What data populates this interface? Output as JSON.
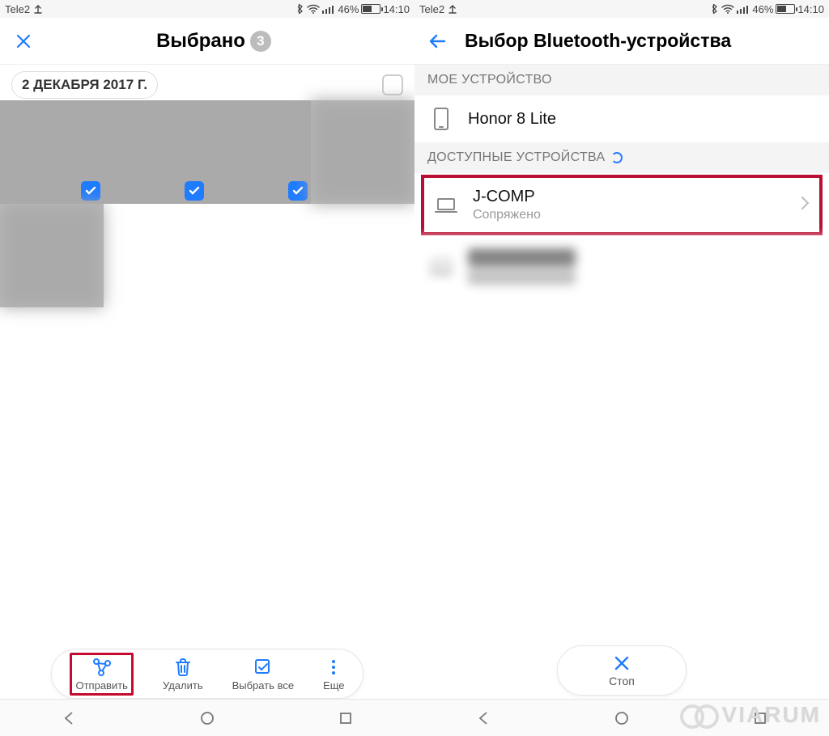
{
  "status": {
    "carrier": "Tele2",
    "battery_pct": "46%",
    "time": "14:10"
  },
  "left": {
    "title": "Выбрано",
    "selected_count": "3",
    "date_label": "2 ДЕКАБРЯ 2017 Г.",
    "toolbar": {
      "send": "Отправить",
      "delete": "Удалить",
      "select_all": "Выбрать все",
      "more": "Еще"
    }
  },
  "right": {
    "title": "Выбор Bluetooth-устройства",
    "section_my": "МОЕ УСТРОЙСТВО",
    "my_device": "Honor 8 Lite",
    "section_available": "ДОСТУПНЫЕ УСТРОЙСТВА",
    "device1_name": "J-COMP",
    "device1_status": "Сопряжено",
    "stop_label": "Стоп"
  },
  "watermark": "VIARUM"
}
